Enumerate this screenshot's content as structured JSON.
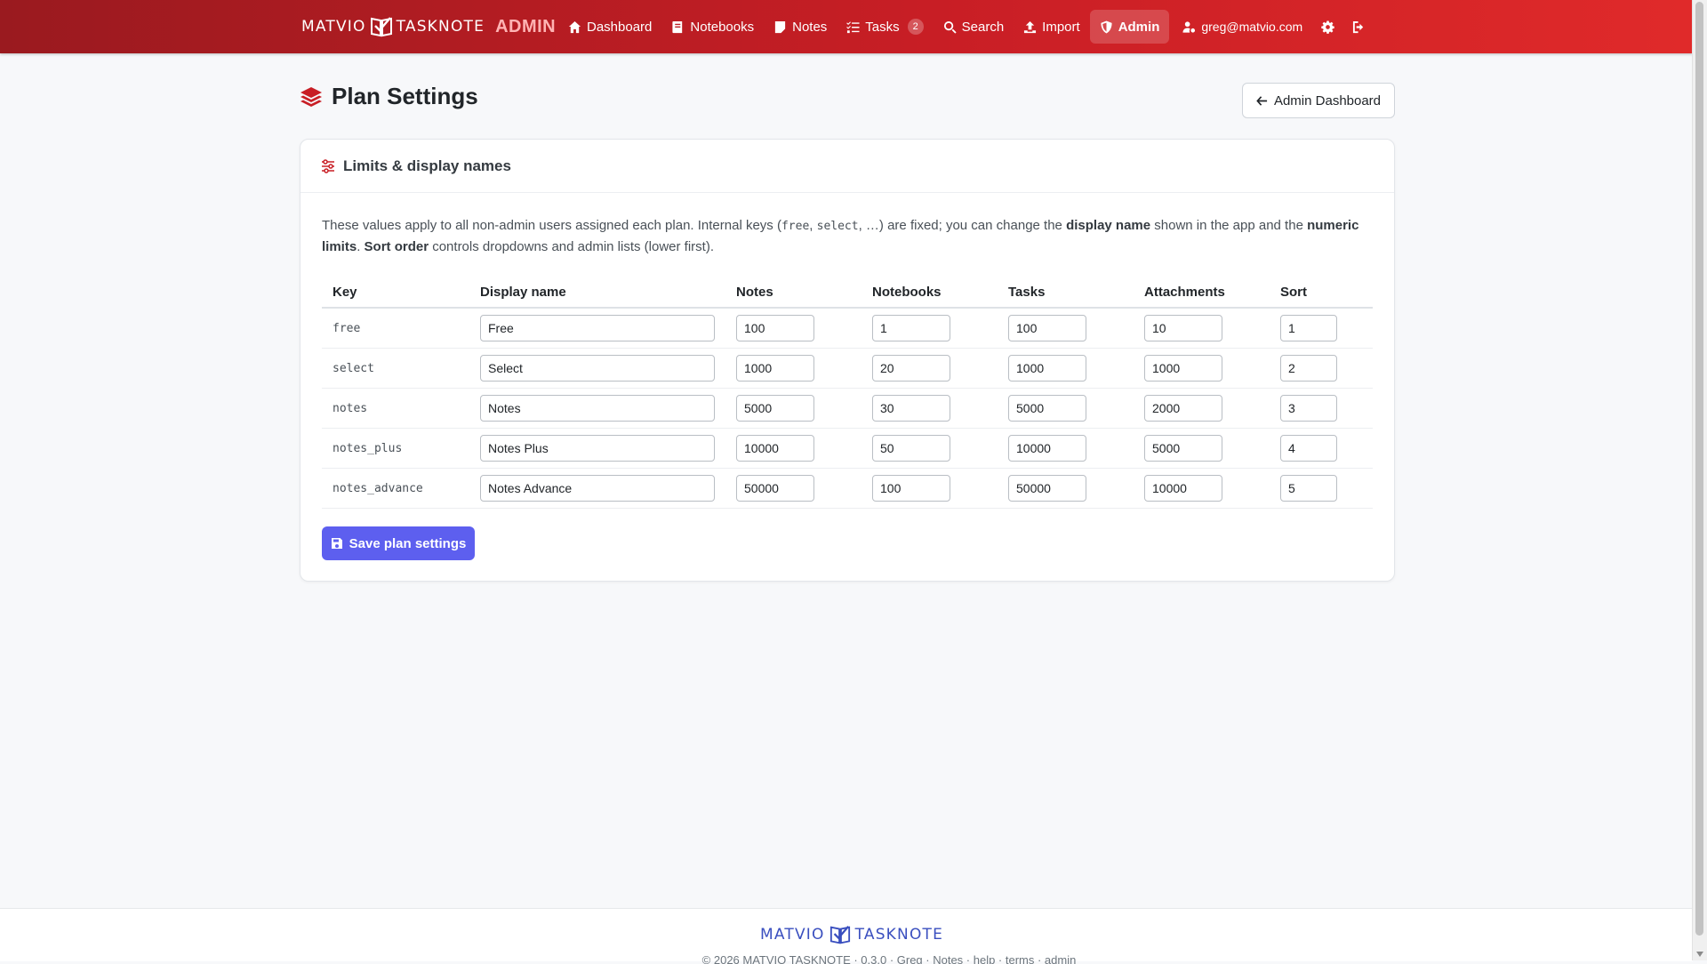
{
  "brand": {
    "left": "MATVIO",
    "right": "TASKNOTE",
    "admin": "ADMIN"
  },
  "nav": {
    "items": [
      {
        "label": "Dashboard",
        "icon": "home-icon"
      },
      {
        "label": "Notebooks",
        "icon": "notebook-icon"
      },
      {
        "label": "Notes",
        "icon": "note-icon"
      },
      {
        "label": "Tasks",
        "icon": "tasks-icon",
        "badge": "2"
      },
      {
        "label": "Search",
        "icon": "search-icon"
      },
      {
        "label": "Import",
        "icon": "upload-icon"
      },
      {
        "label": "Admin",
        "icon": "shield-icon",
        "active": true
      }
    ],
    "user": "greg@matvio.com"
  },
  "page": {
    "title": "Plan Settings",
    "back_button": "Admin Dashboard"
  },
  "card": {
    "title": "Limits & display names",
    "desc": {
      "p1": "These values apply to all non-admin users assigned each plan. Internal keys (",
      "code1": "free",
      "p2": ", ",
      "code2": "select",
      "p3": ", …) are fixed; you can change the ",
      "b1": "display name",
      "p4": " shown in the app and the ",
      "b2": "numeric limits",
      "p5": ". ",
      "b3": "Sort order",
      "p6": " controls dropdowns and admin lists (lower first)."
    },
    "columns": [
      "Key",
      "Display name",
      "Notes",
      "Notebooks",
      "Tasks",
      "Attachments",
      "Sort"
    ],
    "rows": [
      {
        "key": "free",
        "name": "Free",
        "notes": "100",
        "notebooks": "1",
        "tasks": "100",
        "attachments": "10",
        "sort": "1"
      },
      {
        "key": "select",
        "name": "Select",
        "notes": "1000",
        "notebooks": "20",
        "tasks": "1000",
        "attachments": "1000",
        "sort": "2"
      },
      {
        "key": "notes",
        "name": "Notes",
        "notes": "5000",
        "notebooks": "30",
        "tasks": "5000",
        "attachments": "2000",
        "sort": "3"
      },
      {
        "key": "notes_plus",
        "name": "Notes Plus",
        "notes": "10000",
        "notebooks": "50",
        "tasks": "10000",
        "attachments": "5000",
        "sort": "4"
      },
      {
        "key": "notes_advance",
        "name": "Notes Advance",
        "notes": "50000",
        "notebooks": "100",
        "tasks": "50000",
        "attachments": "10000",
        "sort": "5"
      }
    ],
    "save_button": "Save plan settings"
  },
  "footer": {
    "brand_left": "MATVIO",
    "brand_right": "TASKNOTE",
    "copyright": "© 2026 MATVIO TASKNOTE · 0.3.0 · Greg · Notes · help · terms · admin"
  },
  "colors": {
    "navbar": "#c81e25",
    "accent": "#5d5fef",
    "brand_blue": "#3a4fbf"
  }
}
